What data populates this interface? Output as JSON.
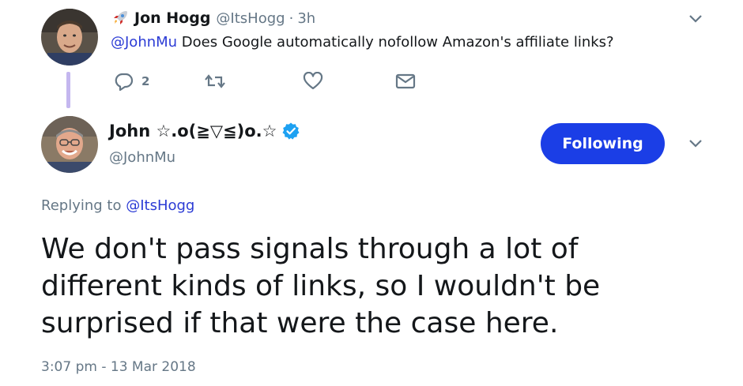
{
  "parent_tweet": {
    "author_name": "Jon Hogg",
    "author_handle": "@ItsHogg",
    "separator": "·",
    "time_ago": "3h",
    "mention": "@JohnMu",
    "text": " Does Google automatically nofollow Amazon's affiliate links?",
    "reply_count": "2",
    "icons": {
      "name_emoji": "rocket-icon",
      "reply": "reply-icon",
      "retweet": "retweet-icon",
      "like": "heart-icon",
      "dm": "envelope-icon",
      "menu": "chevron-down-icon"
    }
  },
  "main_tweet": {
    "author_name": "John ☆.o(≧▽≦)o.☆",
    "author_handle": "@JohnMu",
    "verified": true,
    "follow_label": "Following",
    "replying_prefix": "Replying to ",
    "replying_to": "@ItsHogg",
    "text": "We don't pass signals through a lot of different kinds of links, so I wouldn't be surprised if that were the case here.",
    "timestamp": "3:07 pm - 13 Mar 2018"
  },
  "colors": {
    "accent_blue": "#1b3ee6",
    "mention_blue": "#2b3bd5",
    "secondary_text": "#657786",
    "thread_line": "#c4b7ef",
    "verified_blue": "#1da1f2"
  }
}
